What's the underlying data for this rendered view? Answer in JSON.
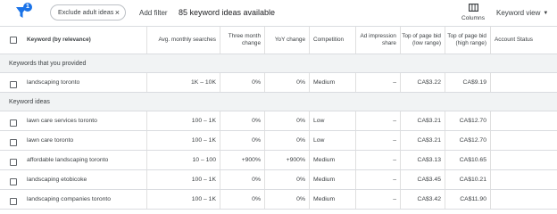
{
  "toolbar": {
    "filter_badge": "1",
    "chip_label": "Exclude adult ideas",
    "chip_close": "×",
    "add_filter": "Add filter",
    "ideas_count": "85 keyword ideas available",
    "columns_label": "Columns",
    "keyword_view": "Keyword view",
    "keyword_view_caret": "▼"
  },
  "table": {
    "headers": {
      "keyword": "Keyword (by relevance)",
      "avg_searches": "Avg. monthly searches",
      "three_month": "Three month change",
      "yoy": "YoY change",
      "competition": "Competition",
      "ad_impression": "Ad impression share",
      "bid_low": "Top of page bid (low range)",
      "bid_high": "Top of page bid (high range)",
      "account_status": "Account Status"
    },
    "groups": [
      {
        "title": "Keywords that you provided",
        "rows": [
          {
            "keyword": "landscaping toronto",
            "avg": "1K – 10K",
            "three": "0%",
            "yoy": "0%",
            "comp": "Medium",
            "imp": "–",
            "low": "CA$3.22",
            "high": "CA$9.19",
            "acct": ""
          }
        ]
      },
      {
        "title": "Keyword ideas",
        "rows": [
          {
            "keyword": "lawn care services toronto",
            "avg": "100 – 1K",
            "three": "0%",
            "yoy": "0%",
            "comp": "Low",
            "imp": "–",
            "low": "CA$3.21",
            "high": "CA$12.70",
            "acct": ""
          },
          {
            "keyword": "lawn care toronto",
            "avg": "100 – 1K",
            "three": "0%",
            "yoy": "0%",
            "comp": "Low",
            "imp": "–",
            "low": "CA$3.21",
            "high": "CA$12.70",
            "acct": ""
          },
          {
            "keyword": "affordable landscaping toronto",
            "avg": "10 – 100",
            "three": "+900%",
            "yoy": "+900%",
            "comp": "Medium",
            "imp": "–",
            "low": "CA$3.13",
            "high": "CA$10.65",
            "acct": ""
          },
          {
            "keyword": "landscaping etobicoke",
            "avg": "100 – 1K",
            "three": "0%",
            "yoy": "0%",
            "comp": "Medium",
            "imp": "–",
            "low": "CA$3.45",
            "high": "CA$10.21",
            "acct": ""
          },
          {
            "keyword": "landscaping companies toronto",
            "avg": "100 – 1K",
            "three": "0%",
            "yoy": "0%",
            "comp": "Medium",
            "imp": "–",
            "low": "CA$3.42",
            "high": "CA$11.90",
            "acct": ""
          }
        ]
      }
    ]
  },
  "colors": {
    "accent": "#1a73e8",
    "group_bg": "#f1f3f4",
    "divider": "#dadce0"
  },
  "icons": {
    "filter": "filter-funnel-icon",
    "close": "close-icon",
    "columns": "columns-icon",
    "caret": "caret-down-icon"
  }
}
